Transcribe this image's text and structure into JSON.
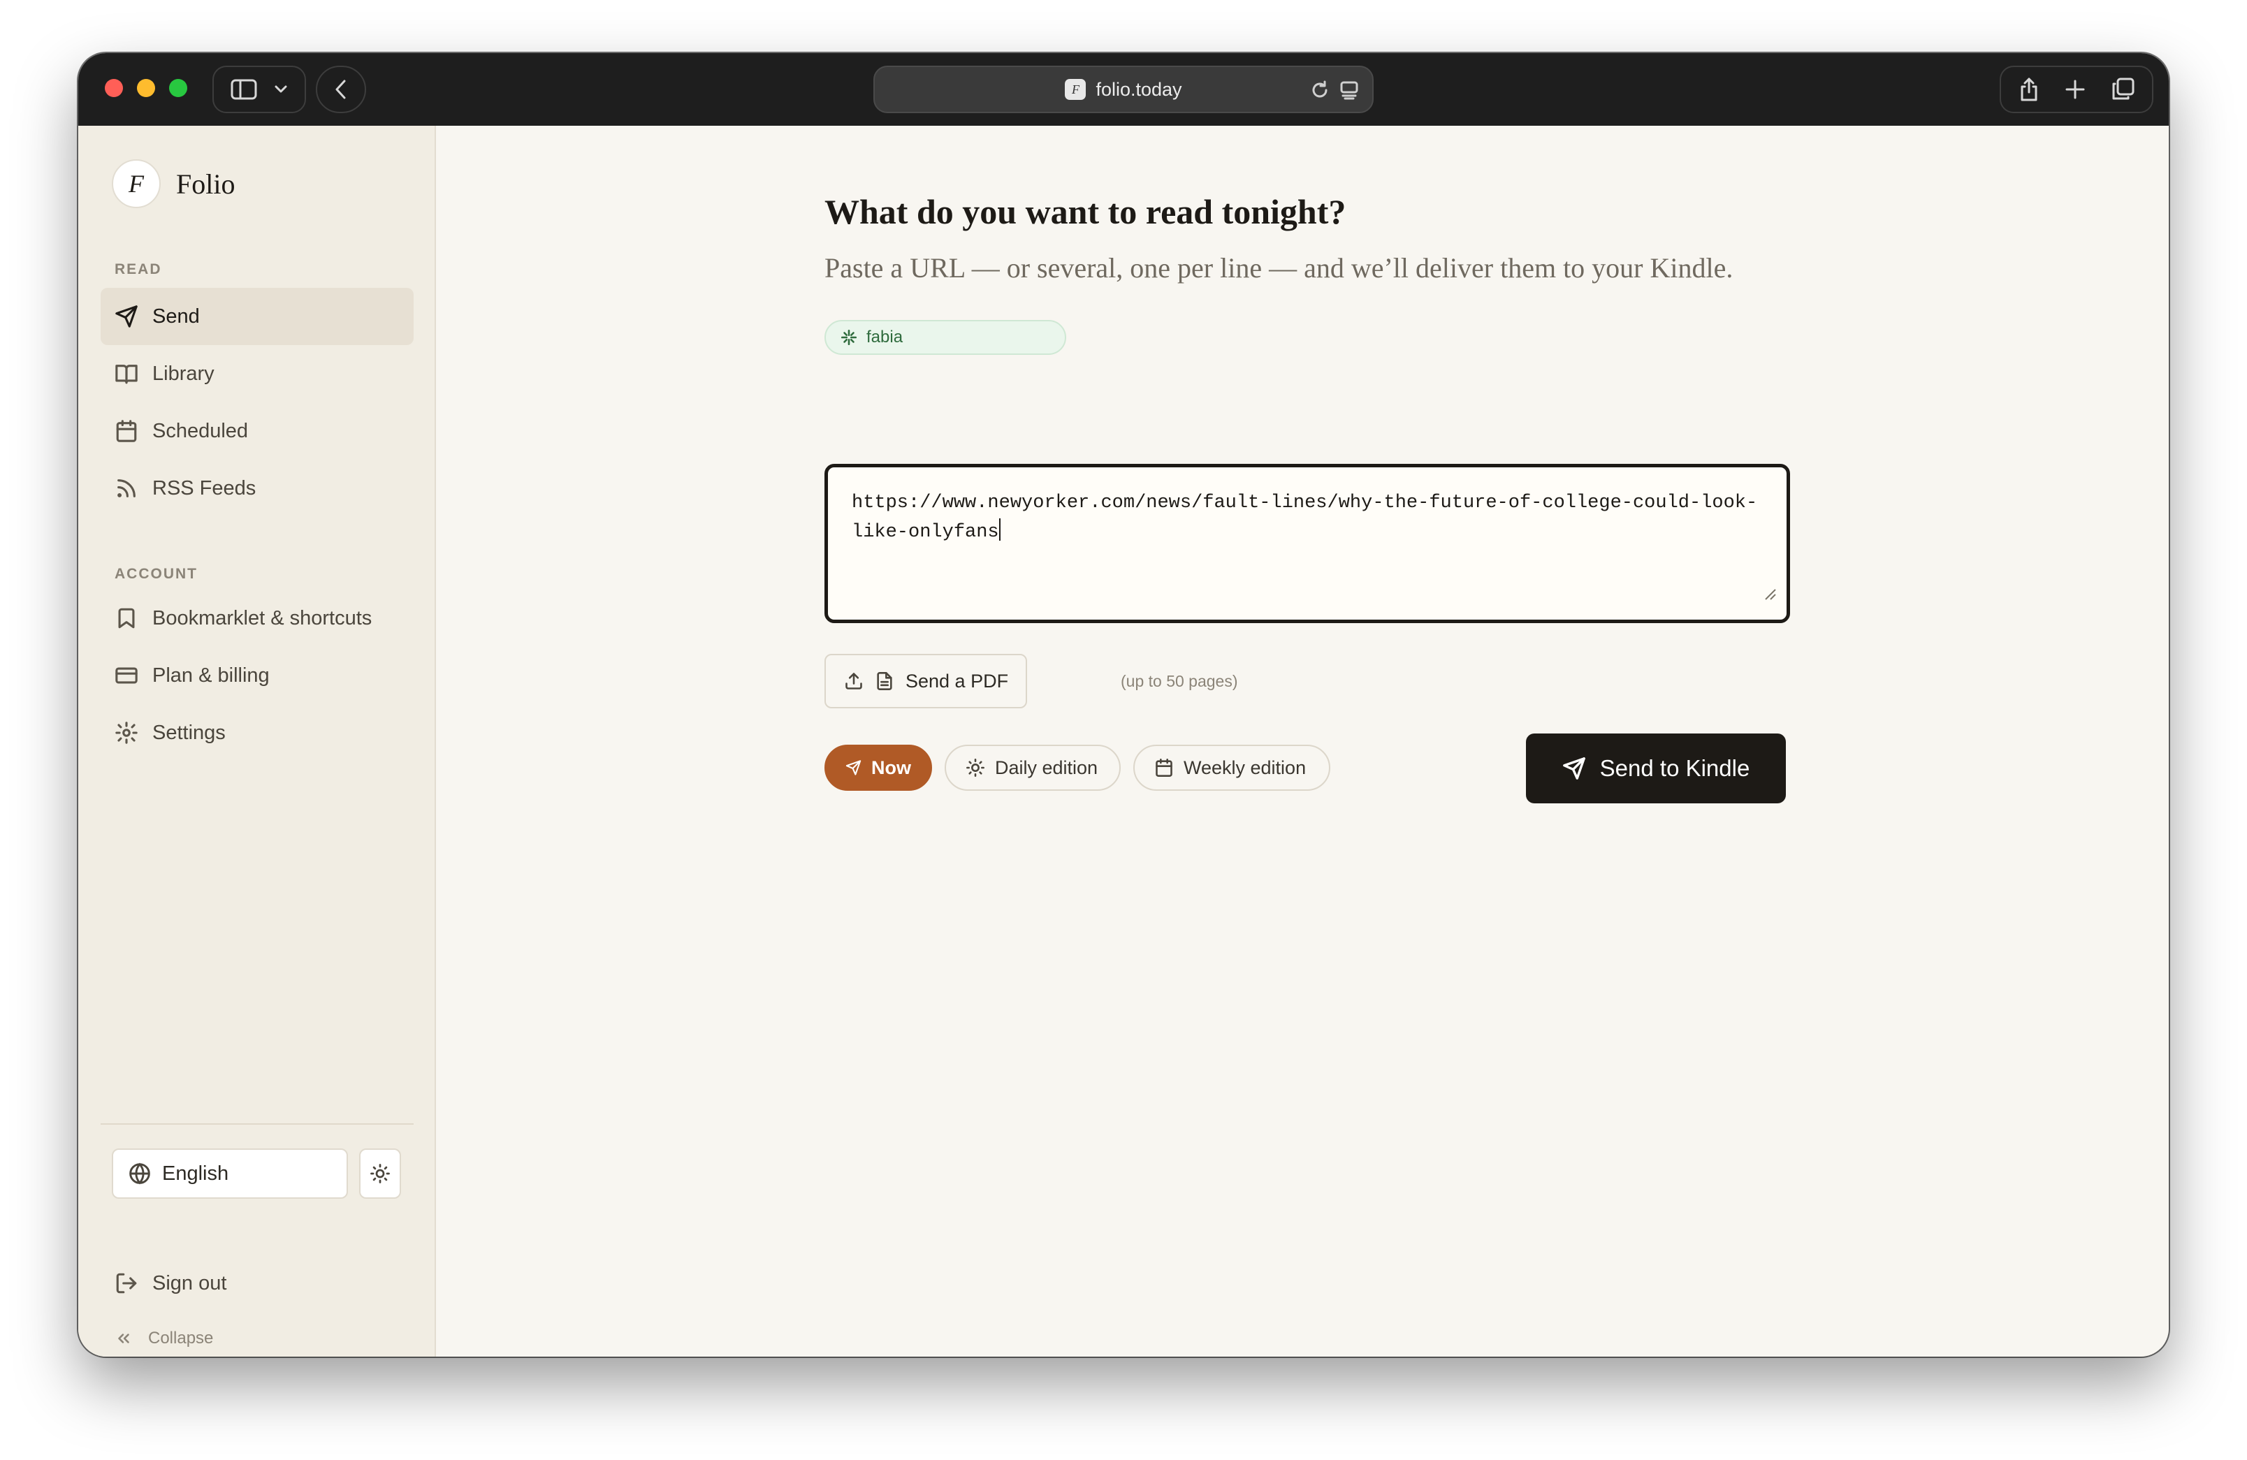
{
  "browser": {
    "url": "folio.today",
    "favicon_letter": "F"
  },
  "sidebar": {
    "brand_letter": "F",
    "brand_name": "Folio",
    "read_label": "READ",
    "read_items": [
      {
        "label": "Send",
        "icon": "send-icon",
        "active": true
      },
      {
        "label": "Library",
        "icon": "book-icon"
      },
      {
        "label": "Scheduled",
        "icon": "calendar-icon"
      },
      {
        "label": "RSS Feeds",
        "icon": "rss-icon"
      }
    ],
    "account_label": "ACCOUNT",
    "account_items": [
      {
        "label": "Bookmarklet & shortcuts",
        "icon": "bookmark-icon"
      },
      {
        "label": "Plan & billing",
        "icon": "credit-card-icon"
      },
      {
        "label": "Settings",
        "icon": "gear-icon"
      }
    ],
    "language": "English",
    "sign_out": "Sign out",
    "collapse": "Collapse"
  },
  "main": {
    "headline": "What do you want to read tonight?",
    "subline": "Paste a URL — or several, one per line — and we’ll deliver them to your Kindle.",
    "user_chip": "fabia",
    "url_input_value": "https://www.newyorker.com/news/fault-lines/why-the-future-of-college-could-look-like-onlyfans",
    "send_pdf": "Send a PDF",
    "pdf_hint": "(up to 50 pages)",
    "schedule_options": [
      "Now",
      "Daily edition",
      "Weekly edition"
    ],
    "selected_schedule": "Now",
    "send_button": "Send to Kindle"
  },
  "colors": {
    "accent": "#b05a26",
    "primary_button": "#1d1a16",
    "sidebar_bg": "#f1ede3",
    "main_bg": "#f8f6f1"
  }
}
